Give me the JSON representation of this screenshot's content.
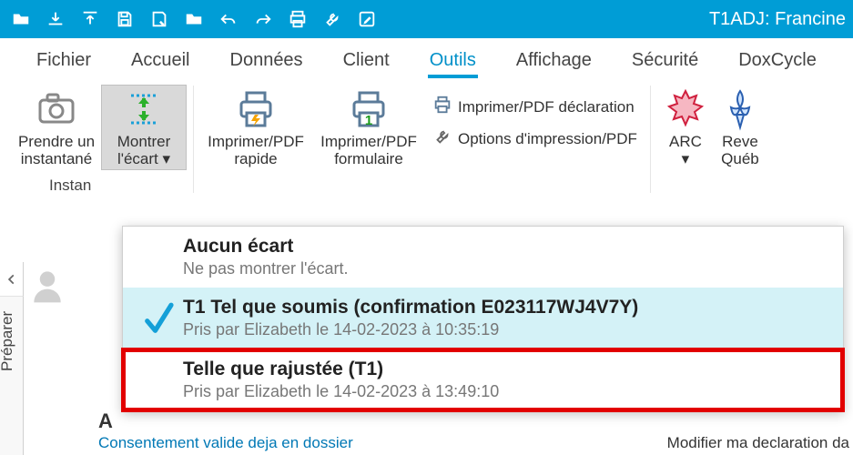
{
  "qat": {
    "title": "T1ADJ: Francine"
  },
  "tabs": {
    "t0": "Fichier",
    "t1": "Accueil",
    "t2": "Données",
    "t3": "Client",
    "t4": "Outils",
    "t5": "Affichage",
    "t6": "Sécurité",
    "t7": "DoxCycle"
  },
  "ribbon": {
    "snapshot": "Prendre un\ninstantané",
    "variance": "Montrer\nl'écart ▾",
    "group1_label": "Instan",
    "qprint": "Imprimer/PDF\nrapide",
    "fprint": "Imprimer/PDF\nformulaire",
    "declprint": "Imprimer/PDF déclaration",
    "printopts": "Options d'impression/PDF",
    "arc": "ARC\n▾",
    "revqc": "Reve\nQuéb"
  },
  "dropdown": {
    "i0": {
      "title": "Aucun écart",
      "sub": "Ne pas montrer l'écart."
    },
    "i1": {
      "title": "T1 Tel que soumis (confirmation E023117WJ4V7Y)",
      "sub": "Pris par Elizabeth le 14-02-2023 à 10:35:19"
    },
    "i2": {
      "title": "Telle que rajustée (T1)",
      "sub": "Pris par Elizabeth le 14-02-2023 à 13:49:10"
    }
  },
  "gutter": {
    "prepare": "Préparer"
  },
  "peek": {
    "A": "A",
    "left": "Consentement valide deja en dossier",
    "right": "Modifier ma declaration da"
  }
}
